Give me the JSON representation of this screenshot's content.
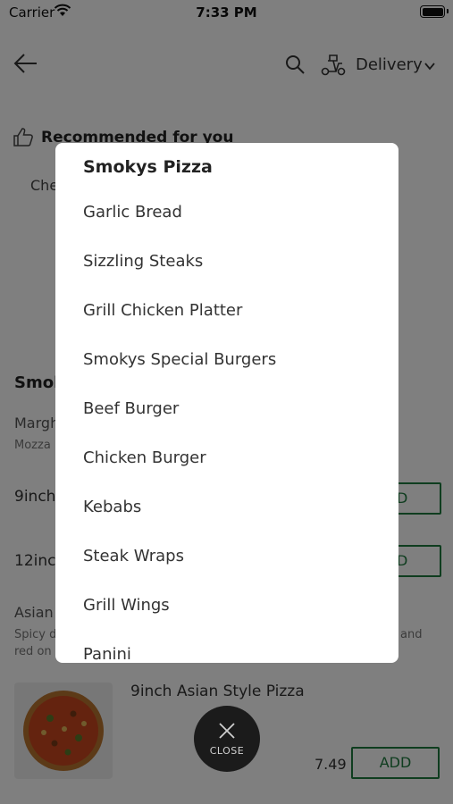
{
  "status_bar": {
    "carrier": "Carrier",
    "time": "7:33 PM"
  },
  "header": {
    "delivery_label": "Delivery"
  },
  "recommended": {
    "title": "Recommended for you",
    "first_item_partial": "Che"
  },
  "section": {
    "title_partial": "Smok",
    "item_name_partial": "Margh",
    "item_desc_partial": "Mozza",
    "size1_partial": "9inch",
    "size2_partial": "12inc",
    "add1_partial": "DD",
    "add2_partial": "DD",
    "item2_name_partial": "Asian",
    "item2_desc_left": "Spicy d",
    "item2_desc_right": "and",
    "item2_desc_line2": "red on"
  },
  "product": {
    "name": "9inch Asian Style Pizza",
    "price": "7.49",
    "add_label": "ADD"
  },
  "category_modal": {
    "title": "Smokys Pizza",
    "items": [
      "Garlic Bread",
      "Sizzling Steaks",
      "Grill Chicken Platter",
      "Smokys Special Burgers",
      "Beef Burger",
      "Chicken Burger",
      "Kebabs",
      "Steak Wraps",
      "Grill Wings",
      "Panini"
    ]
  },
  "close_button": {
    "label": "CLOSE"
  },
  "colors": {
    "accent": "#1f7a3f",
    "overlay": "rgba(0,0,0,0.5)",
    "close_bg": "#1b1b1b"
  }
}
